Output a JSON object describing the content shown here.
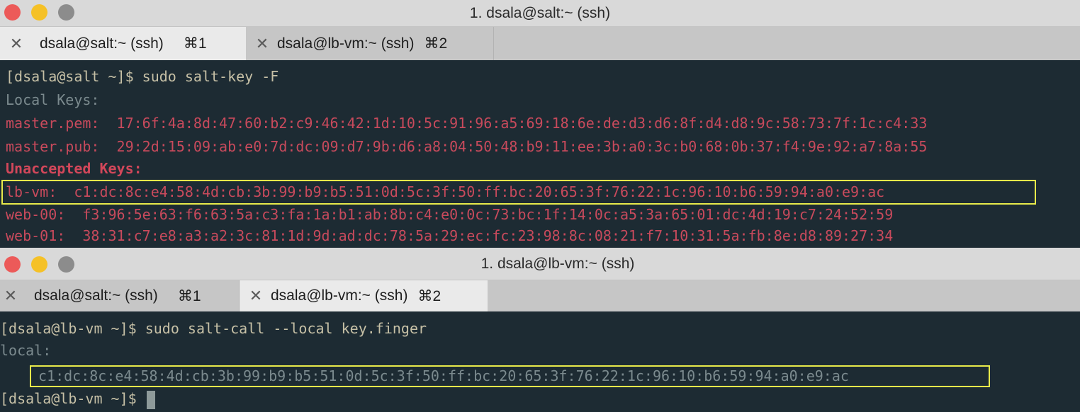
{
  "top_window": {
    "title": "1. dsala@salt:~ (ssh)",
    "tabs": [
      {
        "title": "dsala@salt:~ (ssh)",
        "shortcut": "⌘1",
        "active": true
      },
      {
        "title": "dsala@lb-vm:~ (ssh)",
        "shortcut": "⌘2",
        "active": false
      }
    ],
    "lines": {
      "command": "[dsala@salt ~]$ sudo salt-key -F",
      "local_keys_header": "Local Keys:",
      "master_pem": "master.pem:  17:6f:4a:8d:47:60:b2:c9:46:42:1d:10:5c:91:96:a5:69:18:6e:de:d3:d6:8f:d4:d8:9c:58:73:7f:1c:c4:33",
      "master_pub": "master.pub:  29:2d:15:09:ab:e0:7d:dc:09:d7:9b:d6:a8:04:50:48:b9:11:ee:3b:a0:3c:b0:68:0b:37:f4:9e:92:a7:8a:55",
      "unaccepted_header": "Unaccepted Keys:",
      "lb_vm": "lb-vm:  c1:dc:8c:e4:58:4d:cb:3b:99:b9:b5:51:0d:5c:3f:50:ff:bc:20:65:3f:76:22:1c:96:10:b6:59:94:a0:e9:ac",
      "web_00": "web-00:  f3:96:5e:63:f6:63:5a:c3:fa:1a:b1:ab:8b:c4:e0:0c:73:bc:1f:14:0c:a5:3a:65:01:dc:4d:19:c7:24:52:59",
      "web_01": "web-01:  38:31:c7:e8:a3:a2:3c:81:1d:9d:ad:dc:78:5a:29:ec:fc:23:98:8c:08:21:f7:10:31:5a:fb:8e:d8:89:27:34"
    }
  },
  "bottom_window": {
    "title": "1. dsala@lb-vm:~ (ssh)",
    "tabs": [
      {
        "title": "dsala@salt:~ (ssh)",
        "shortcut": "⌘1",
        "active": false
      },
      {
        "title": "dsala@lb-vm:~ (ssh)",
        "shortcut": "⌘2",
        "active": true
      }
    ],
    "lines": {
      "command": "[dsala@lb-vm ~]$ sudo salt-call --local key.finger",
      "local_label": "local:",
      "fingerprint": "c1:dc:8c:e4:58:4d:cb:3b:99:b9:b5:51:0d:5c:3f:50:ff:bc:20:65:3f:76:22:1c:96:10:b6:59:94:a0:e9:ac",
      "prompt": "[dsala@lb-vm ~]$ "
    }
  },
  "colors": {
    "terminal_bg": "#1d2b33",
    "prompt_text": "#c6c0a6",
    "key_text_red": "#c84a5c",
    "dim_text": "#7b8a8e",
    "highlight_box": "#e8ea4a"
  },
  "icons": [
    "close-icon",
    "traffic-light-close-icon",
    "traffic-light-minimize-icon",
    "traffic-light-zoom-icon"
  ]
}
